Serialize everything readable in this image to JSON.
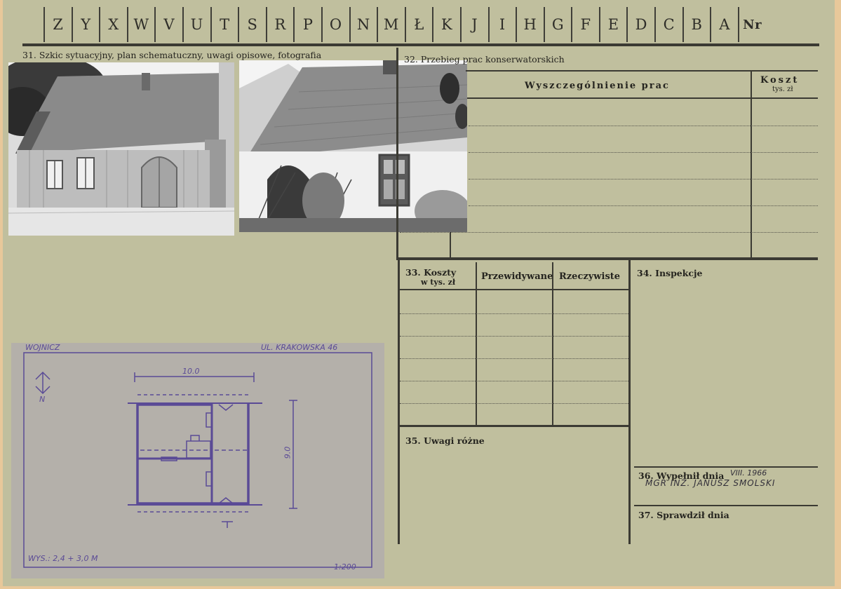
{
  "letters": [
    "Z",
    "Y",
    "X",
    "W",
    "V",
    "U",
    "T",
    "S",
    "R",
    "P",
    "O",
    "N",
    "M",
    "Ł",
    "K",
    "J",
    "I",
    "H",
    "G",
    "F",
    "E",
    "D",
    "C",
    "B",
    "A",
    "Nr"
  ],
  "sections": {
    "s31": "31. Szkic sytuacyjny, plan schematuczny, uwagi opisowe, fotografia",
    "s32": "32. Przebieg prac konserwatorskich",
    "s33": "33. Koszty",
    "s33_unit": "w tys. zł",
    "s34": "34. Inspekcje",
    "s35": "35. Uwagi różne",
    "s36": "36. Wypełnił dnia",
    "s37": "37. Sprawdził dnia"
  },
  "works_table": {
    "col_works": "Wyszczególnienie prac",
    "col_cost": "Koszt",
    "col_cost_unit": "tys. zł"
  },
  "costs_table": {
    "col_planned": "Przewidywane",
    "col_actual": "Rzeczywiste"
  },
  "handwritten": {
    "fill_date": "VIII. 1966",
    "filled_by": "MGR INŻ. JANUSZ SMOLSKI"
  },
  "sketch": {
    "town": "WOJNICZ",
    "street": "UL. KRAKOWSKA 46",
    "dim_width": "10.0",
    "dim_depth": "9.0",
    "north": "N",
    "height_note": "WYS.: 2,4 + 3,0 M",
    "scale": "1:200"
  },
  "colors": {
    "card": "#c0bf9e",
    "ink": "#3b3a33",
    "sketch_ink": "#5a4a96"
  }
}
